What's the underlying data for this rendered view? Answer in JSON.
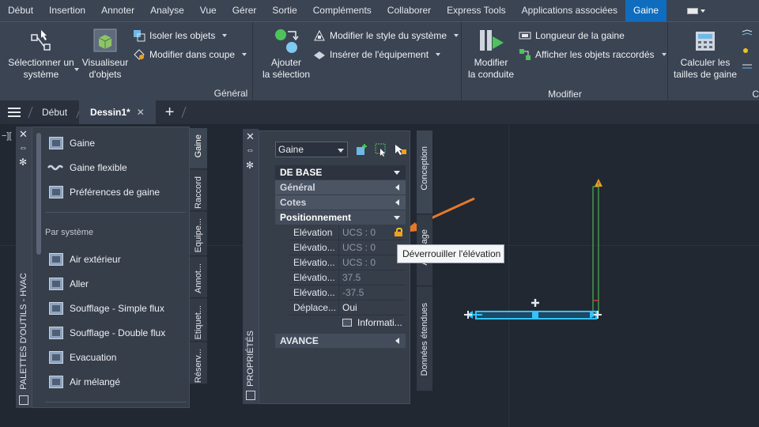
{
  "ribbon_tabs": [
    "Début",
    "Insertion",
    "Annoter",
    "Analyse",
    "Vue",
    "Gérer",
    "Sortie",
    "Compléments",
    "Collaborer",
    "Express Tools",
    "Applications associées",
    "Gaine"
  ],
  "ribbon_active_tab": "Gaine",
  "ribbon": {
    "general": {
      "title": "Général",
      "select_line1": "Sélectionner un",
      "select_line2": "système",
      "viewer_line1": "Visualiseur",
      "viewer_line2": "d'objets",
      "isolate": "Isoler les objets",
      "modify_cut": "Modifier dans coupe",
      "add_line1": "Ajouter",
      "add_line2": "la sélection",
      "modify_style": "Modifier le style du système",
      "insert_equipment": "Insérer de l'équipement"
    },
    "modify": {
      "title": "Modifier",
      "conduit_line1": "Modifier",
      "conduit_line2": "la conduite",
      "duct_length": "Longueur de la gaine",
      "show_connected": "Afficher les objets raccordés"
    },
    "calc": {
      "line1": "Calculer les",
      "line2": "tailles de gaine",
      "clipped_title": "C"
    }
  },
  "file_tabs": {
    "start": "Début",
    "active": "Dessin1*",
    "close": "✕",
    "new": "+"
  },
  "viewport_label": "−][",
  "tool_palette": {
    "title": "PALETTES D'OUTILS - HVAC",
    "items_top": [
      "Gaine",
      "Gaine flexible",
      "Préférences de gaine"
    ],
    "section_label": "Par système",
    "items_system": [
      "Air extérieur",
      "Aller",
      "Soufflage - Simple flux",
      "Soufflage - Double flux",
      "Evacuation",
      "Air mélangé"
    ],
    "side_tabs": [
      "Gaine",
      "Raccord",
      "Equipe...",
      "Annot...",
      "Etiquet...",
      "Réserv..."
    ]
  },
  "properties": {
    "title": "PROPRIÉTÉS",
    "object_select": "Gaine",
    "sections": {
      "basic": "DE BASE",
      "general": "Général",
      "dimensions": "Cotes",
      "positioning": "Positionnement",
      "advanced": "AVANCE"
    },
    "rows": [
      {
        "key": "Elévation",
        "value": "UCS : 0"
      },
      {
        "key": "Elévatio...",
        "value": "UCS : 0"
      },
      {
        "key": "Elévatio...",
        "value": "UCS : 0"
      },
      {
        "key": "Elévatio...",
        "value": "37.5"
      },
      {
        "key": "Elévatio...",
        "value": "-37.5"
      },
      {
        "key": "Déplace...",
        "value": "Oui"
      }
    ],
    "info_label": "Informati...",
    "side_tabs": [
      "Conception",
      "Affichage",
      "Données étendues"
    ],
    "tooltip": "Déverrouiller l'élévation"
  },
  "colors": {
    "accent": "#0f6dbf",
    "ribbon_bg": "#3b4453",
    "canvas_bg": "#212832",
    "duct_highlight": "#34c2ff",
    "arrow": "#e6782a",
    "warning": "#f0a020"
  }
}
